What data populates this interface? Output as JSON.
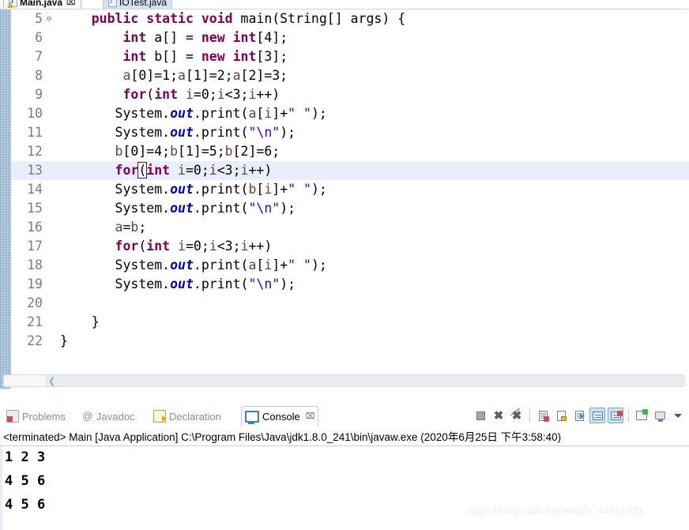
{
  "editor": {
    "tabs": [
      {
        "label": "Main.java",
        "active": true,
        "close_glyph": "⌧",
        "icon": "java-file-warning-icon"
      },
      {
        "label": "IOTest.java",
        "active": false,
        "close_glyph": "",
        "icon": "java-file-icon"
      }
    ],
    "highlighted_line": 13,
    "lines": [
      {
        "number": "5",
        "fold": "⊖",
        "indent": "    ",
        "tokens": [
          {
            "t": "public ",
            "c": "kw"
          },
          {
            "t": "static ",
            "c": "kw"
          },
          {
            "t": "void ",
            "c": "kw"
          },
          {
            "t": "main(String[] args) {",
            "c": "plain"
          }
        ]
      },
      {
        "number": "6",
        "fold": "",
        "indent": "        ",
        "tokens": [
          {
            "t": "int ",
            "c": "kw"
          },
          {
            "t": "a[] = ",
            "c": "plain"
          },
          {
            "t": "new ",
            "c": "kw"
          },
          {
            "t": "int",
            "c": "kw"
          },
          {
            "t": "[4];",
            "c": "plain"
          }
        ]
      },
      {
        "number": "7",
        "fold": "",
        "indent": "        ",
        "tokens": [
          {
            "t": "int ",
            "c": "kw"
          },
          {
            "t": "b[] = ",
            "c": "plain"
          },
          {
            "t": "new ",
            "c": "kw"
          },
          {
            "t": "int",
            "c": "kw"
          },
          {
            "t": "[3];",
            "c": "plain"
          }
        ]
      },
      {
        "number": "8",
        "fold": "",
        "indent": "        ",
        "tokens": [
          {
            "t": "a",
            "c": "loc"
          },
          {
            "t": "[0]=1;",
            "c": "plain"
          },
          {
            "t": "a",
            "c": "loc"
          },
          {
            "t": "[1]=2;",
            "c": "plain"
          },
          {
            "t": "a",
            "c": "loc"
          },
          {
            "t": "[2]=3;",
            "c": "plain"
          }
        ]
      },
      {
        "number": "9",
        "fold": "",
        "indent": "        ",
        "tokens": [
          {
            "t": "for",
            "c": "kw"
          },
          {
            "t": "(",
            "c": "plain"
          },
          {
            "t": "int ",
            "c": "kw"
          },
          {
            "t": "i",
            "c": "loc"
          },
          {
            "t": "=0;",
            "c": "plain"
          },
          {
            "t": "i",
            "c": "loc"
          },
          {
            "t": "<3;",
            "c": "plain"
          },
          {
            "t": "i",
            "c": "loc"
          },
          {
            "t": "++)",
            "c": "plain"
          }
        ]
      },
      {
        "number": "10",
        "fold": "",
        "indent": "       ",
        "tokens": [
          {
            "t": "System.",
            "c": "plain"
          },
          {
            "t": "out",
            "c": "fld"
          },
          {
            "t": ".print(",
            "c": "plain"
          },
          {
            "t": "a",
            "c": "loc"
          },
          {
            "t": "[",
            "c": "plain"
          },
          {
            "t": "i",
            "c": "loc"
          },
          {
            "t": "]+",
            "c": "plain"
          },
          {
            "t": "\" \"",
            "c": "str"
          },
          {
            "t": ");",
            "c": "plain"
          }
        ]
      },
      {
        "number": "11",
        "fold": "",
        "indent": "       ",
        "tokens": [
          {
            "t": "System.",
            "c": "plain"
          },
          {
            "t": "out",
            "c": "fld"
          },
          {
            "t": ".print(",
            "c": "plain"
          },
          {
            "t": "\"\\n\"",
            "c": "str"
          },
          {
            "t": ");",
            "c": "plain"
          }
        ]
      },
      {
        "number": "12",
        "fold": "",
        "indent": "       ",
        "tokens": [
          {
            "t": "b",
            "c": "loc"
          },
          {
            "t": "[0]=4;",
            "c": "plain"
          },
          {
            "t": "b",
            "c": "loc"
          },
          {
            "t": "[1]=5;",
            "c": "plain"
          },
          {
            "t": "b",
            "c": "loc"
          },
          {
            "t": "[2]=6;",
            "c": "plain"
          }
        ]
      },
      {
        "number": "13",
        "fold": "",
        "indent": "       ",
        "tokens": [
          {
            "t": "for",
            "c": "kw"
          },
          {
            "t": "(",
            "c": "plain bm"
          },
          {
            "t": "int ",
            "c": "kw"
          },
          {
            "t": "i",
            "c": "loc"
          },
          {
            "t": "=0;",
            "c": "plain"
          },
          {
            "t": "i",
            "c": "loc"
          },
          {
            "t": "<3;",
            "c": "plain"
          },
          {
            "t": "i",
            "c": "loc"
          },
          {
            "t": "++)",
            "c": "plain"
          }
        ]
      },
      {
        "number": "14",
        "fold": "",
        "indent": "       ",
        "tokens": [
          {
            "t": "System.",
            "c": "plain"
          },
          {
            "t": "out",
            "c": "fld"
          },
          {
            "t": ".print(",
            "c": "plain"
          },
          {
            "t": "b",
            "c": "loc"
          },
          {
            "t": "[",
            "c": "plain"
          },
          {
            "t": "i",
            "c": "loc"
          },
          {
            "t": "]+",
            "c": "plain"
          },
          {
            "t": "\" \"",
            "c": "str"
          },
          {
            "t": ");",
            "c": "plain"
          }
        ]
      },
      {
        "number": "15",
        "fold": "",
        "indent": "       ",
        "tokens": [
          {
            "t": "System.",
            "c": "plain"
          },
          {
            "t": "out",
            "c": "fld"
          },
          {
            "t": ".print(",
            "c": "plain"
          },
          {
            "t": "\"\\n\"",
            "c": "str"
          },
          {
            "t": ");",
            "c": "plain"
          }
        ]
      },
      {
        "number": "16",
        "fold": "",
        "indent": "       ",
        "tokens": [
          {
            "t": "a",
            "c": "loc"
          },
          {
            "t": "=",
            "c": "plain"
          },
          {
            "t": "b",
            "c": "loc"
          },
          {
            "t": ";",
            "c": "plain"
          }
        ]
      },
      {
        "number": "17",
        "fold": "",
        "indent": "       ",
        "tokens": [
          {
            "t": "for",
            "c": "kw"
          },
          {
            "t": "(",
            "c": "plain"
          },
          {
            "t": "int ",
            "c": "kw"
          },
          {
            "t": "i",
            "c": "loc"
          },
          {
            "t": "=0;",
            "c": "plain"
          },
          {
            "t": "i",
            "c": "loc"
          },
          {
            "t": "<3;",
            "c": "plain"
          },
          {
            "t": "i",
            "c": "loc"
          },
          {
            "t": "++)",
            "c": "plain"
          }
        ]
      },
      {
        "number": "18",
        "fold": "",
        "indent": "       ",
        "tokens": [
          {
            "t": "System.",
            "c": "plain"
          },
          {
            "t": "out",
            "c": "fld"
          },
          {
            "t": ".print(",
            "c": "plain"
          },
          {
            "t": "a",
            "c": "loc"
          },
          {
            "t": "[",
            "c": "plain"
          },
          {
            "t": "i",
            "c": "loc"
          },
          {
            "t": "]+",
            "c": "plain"
          },
          {
            "t": "\" \"",
            "c": "str"
          },
          {
            "t": ");",
            "c": "plain"
          }
        ]
      },
      {
        "number": "19",
        "fold": "",
        "indent": "       ",
        "tokens": [
          {
            "t": "System.",
            "c": "plain"
          },
          {
            "t": "out",
            "c": "fld"
          },
          {
            "t": ".print(",
            "c": "plain"
          },
          {
            "t": "\"\\n\"",
            "c": "str"
          },
          {
            "t": ");",
            "c": "plain"
          }
        ]
      },
      {
        "number": "20",
        "fold": "",
        "indent": "",
        "tokens": []
      },
      {
        "number": "21",
        "fold": "",
        "indent": "    ",
        "tokens": [
          {
            "t": "}",
            "c": "plain"
          }
        ]
      },
      {
        "number": "22",
        "fold": "",
        "indent": "",
        "tokens": [
          {
            "t": "}",
            "c": "plain"
          }
        ]
      }
    ]
  },
  "panel": {
    "tabs": [
      {
        "label": "Problems",
        "icon": "problems-icon",
        "active": false
      },
      {
        "label": "Javadoc",
        "icon": "javadoc-at-icon",
        "active": false
      },
      {
        "label": "Declaration",
        "icon": "declaration-icon",
        "active": false
      },
      {
        "label": "Console",
        "icon": "console-icon",
        "active": true,
        "close_glyph": "⌧"
      }
    ],
    "toolbar": [
      {
        "name": "terminate-button",
        "kind": "stop"
      },
      {
        "name": "remove-launch-button",
        "kind": "x"
      },
      {
        "name": "remove-all-terminated-button",
        "kind": "xx"
      },
      {
        "name": "separator-1",
        "kind": "sep"
      },
      {
        "name": "clear-console-button",
        "kind": "doc-x"
      },
      {
        "name": "scroll-lock-button",
        "kind": "lock"
      },
      {
        "name": "word-wrap-button",
        "kind": "doc-arrow"
      },
      {
        "name": "show-console-on-output-button",
        "kind": "scr",
        "selected": true
      },
      {
        "name": "show-console-on-error-button",
        "kind": "scr-err",
        "selected": true
      },
      {
        "name": "separator-2",
        "kind": "sep"
      },
      {
        "name": "open-console-button",
        "kind": "newc"
      },
      {
        "name": "display-selected-console-button",
        "kind": "monitor"
      },
      {
        "name": "console-menu-button",
        "kind": "caret"
      }
    ],
    "terminated_line": "<terminated> Main [Java Application] C:\\Program Files\\Java\\jdk1.8.0_241\\bin\\javaw.exe (2020年6月25日 下午3:58:40)",
    "output": [
      "1 2 3",
      "4 5 6",
      "4 5 6"
    ]
  },
  "watermark": "https://blog.csdn.net/weixin_44491423"
}
